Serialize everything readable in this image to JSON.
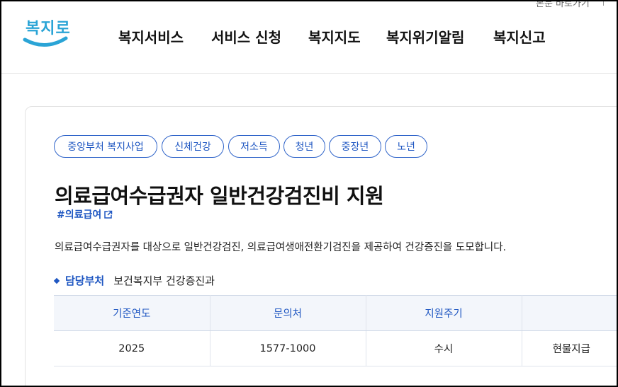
{
  "header": {
    "skip_link": "본문 바로가기",
    "logo_text": "복지로",
    "nav": [
      "복지서비스",
      "서비스 신청",
      "복지지도",
      "복지위기알림",
      "복지신고"
    ]
  },
  "service": {
    "tags": [
      "중앙부처 복지사업",
      "신체건강",
      "저소득",
      "청년",
      "중장년",
      "노년"
    ],
    "title": "의료급여수급권자 일반건강검진비 지원",
    "hashtag": "#의료급여",
    "description": "의료급여수급권자를 대상으로 일반건강검진, 의료급여생애전환기검진을 제공하여 건강증진을 도모합니다.",
    "dept_label": "담당부처",
    "dept_value": "보건복지부 건강증진과",
    "table": {
      "headers": [
        "기준연도",
        "문의처",
        "지원주기",
        ""
      ],
      "row": [
        "2025",
        "1577-1000",
        "수시",
        "현물지급"
      ]
    }
  },
  "colors": {
    "brand_blue": "#1f57c2",
    "logo_blue": "#2aa4d6"
  }
}
